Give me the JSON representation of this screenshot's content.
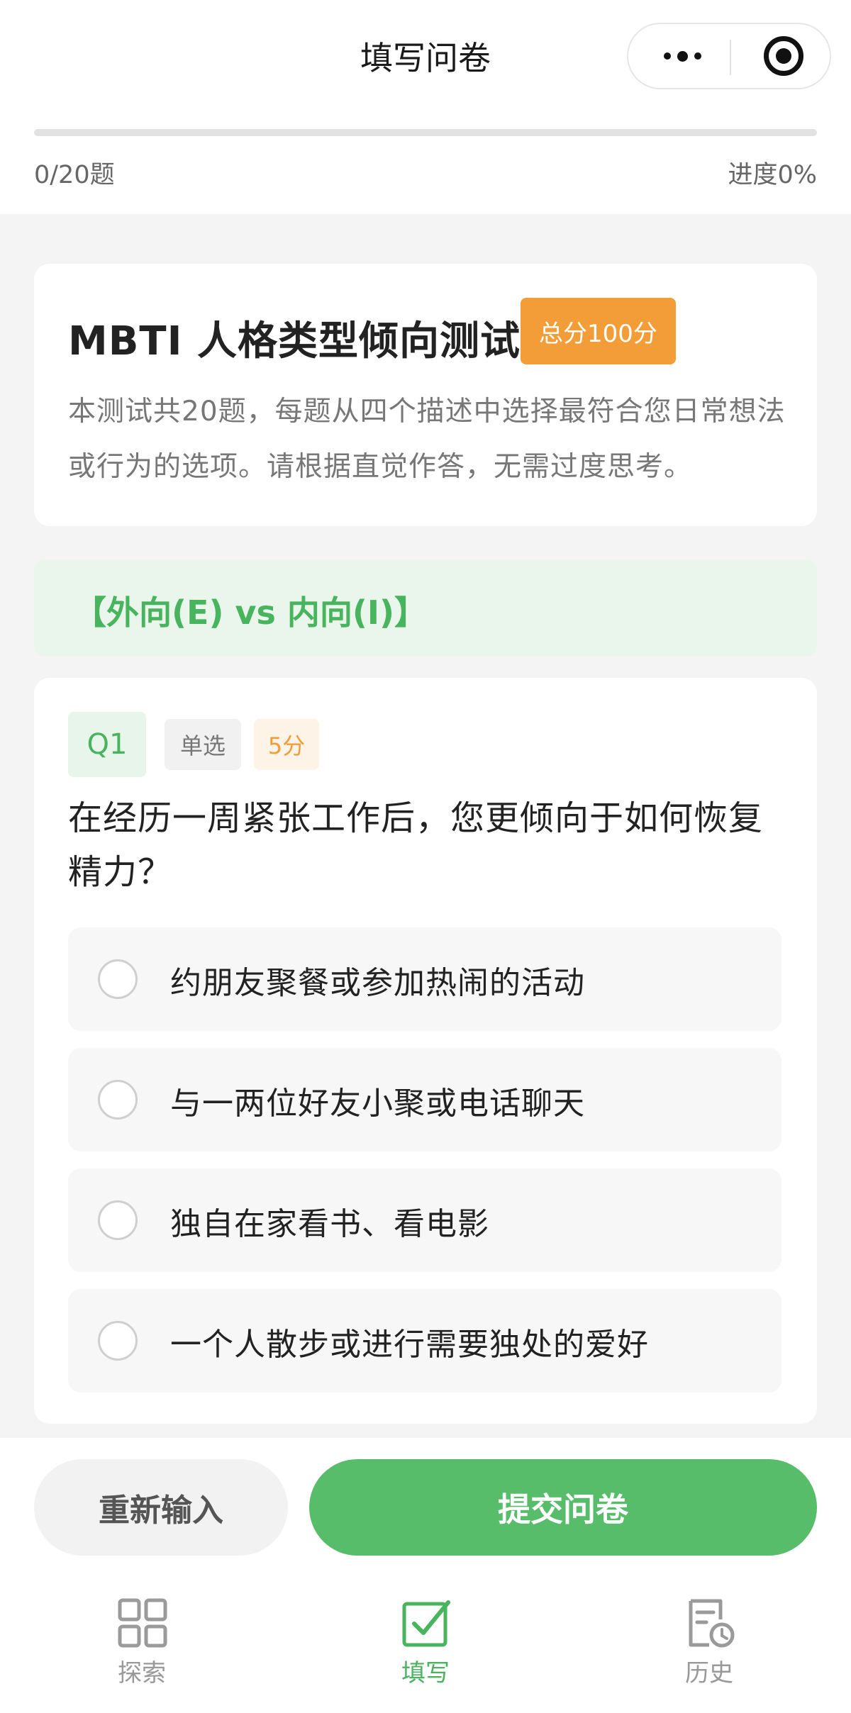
{
  "header": {
    "title": "填写问卷"
  },
  "progress": {
    "count_label": "0/20题",
    "percent_label": "进度0%",
    "fraction": 0
  },
  "intro": {
    "title": "MBTI 人格类型倾向测试",
    "score_badge": "总分100分",
    "description": "本测试共20题，每题从四个描述中选择最符合您日常想法或行为的选项。请根据直觉作答，无需过度思考。"
  },
  "section": {
    "label": "【外向(E) vs 内向(I)】"
  },
  "question": {
    "number": "Q1",
    "type": "单选",
    "score": "5分",
    "text": "在经历一周紧张工作后，您更倾向于如何恢复精力？",
    "options": [
      {
        "label": "约朋友聚餐或参加热闹的活动"
      },
      {
        "label": "与一两位好友小聚或电话聊天"
      },
      {
        "label": "独自在家看书、看电影"
      },
      {
        "label": "一个人散步或进行需要独处的爱好"
      }
    ]
  },
  "actions": {
    "reset_label": "重新输入",
    "submit_label": "提交问卷"
  },
  "tabs": [
    {
      "label": "探索",
      "icon": "grid-icon",
      "active": false
    },
    {
      "label": "填写",
      "icon": "checkbox-icon",
      "active": true
    },
    {
      "label": "历史",
      "icon": "history-document-icon",
      "active": false
    }
  ],
  "colors": {
    "accent_green": "#57bd6a",
    "accent_orange": "#f29d38",
    "background": "#f4f4f4"
  }
}
